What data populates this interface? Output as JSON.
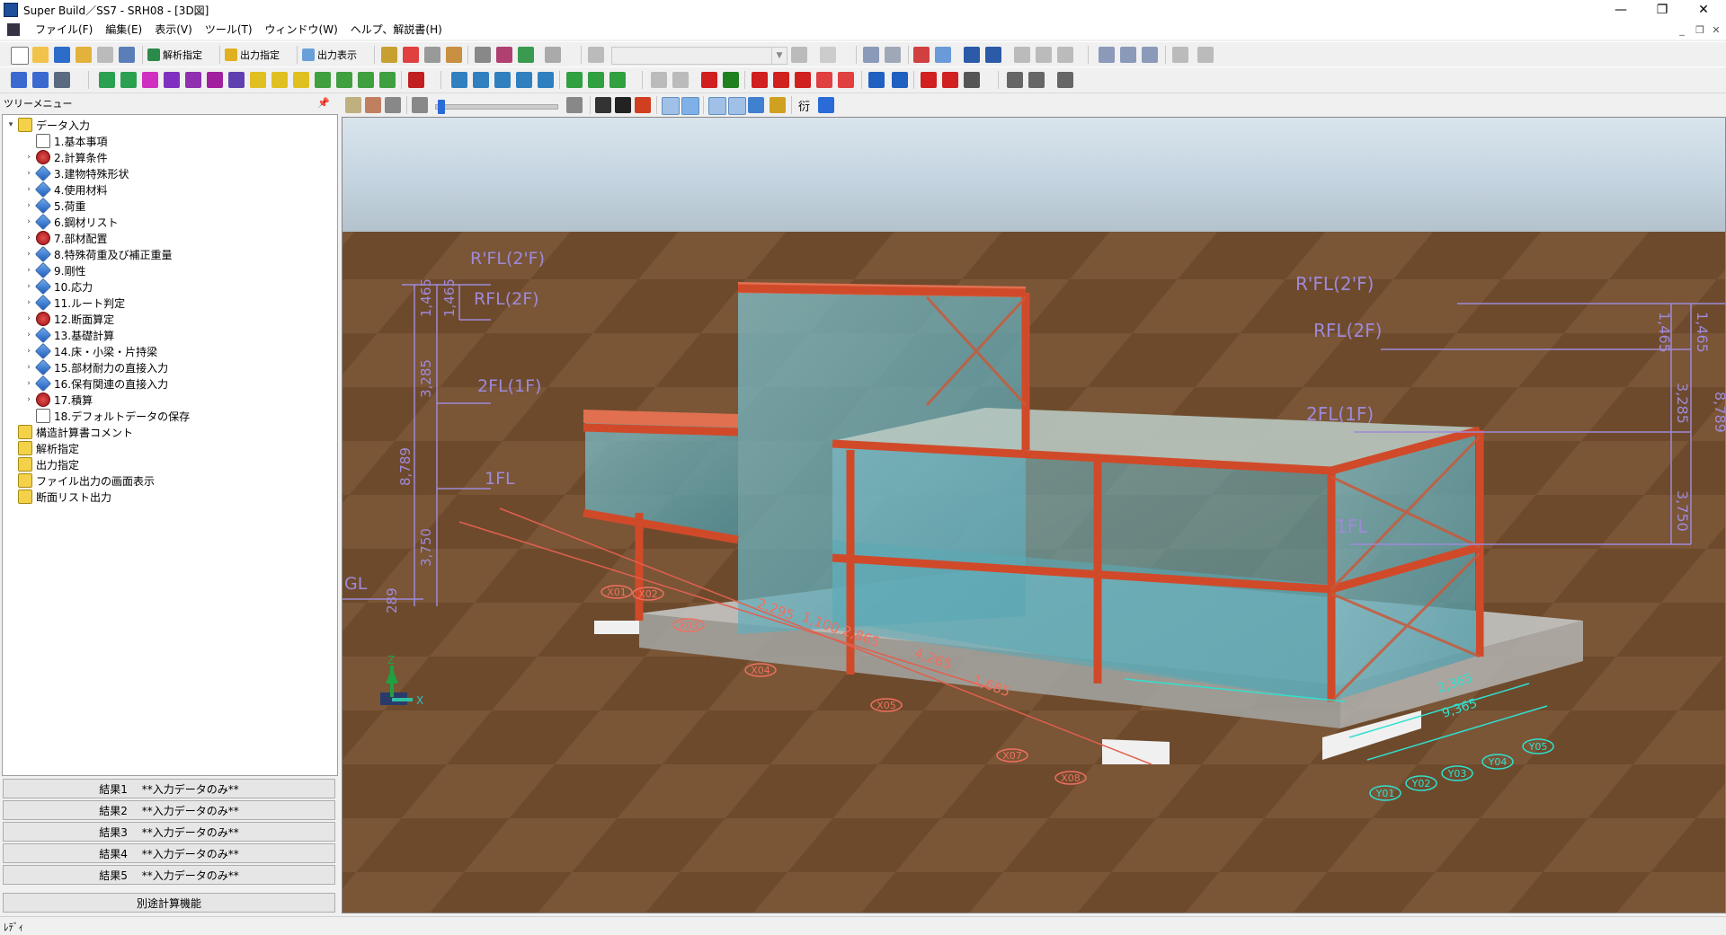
{
  "window": {
    "title": "Super Build／SS7 - SRH08 - [3D図]",
    "minimize": "—",
    "maximize": "❐",
    "close": "✕"
  },
  "mdi": {
    "minimize": "_",
    "restore": "❐",
    "close": "✕"
  },
  "menu": [
    "ファイル(F)",
    "編集(E)",
    "表示(V)",
    "ツール(T)",
    "ウィンドウ(W)",
    "ヘルプ、解説書(H)"
  ],
  "toolbar1": {
    "analysis": "解析指定",
    "output": "出力指定",
    "display": "出力表示"
  },
  "tree": {
    "header": "ツリーメニュー",
    "pin": "📌",
    "items": [
      {
        "label": "データ入力",
        "level": 0,
        "expander": "▾",
        "icon": "data-input-icon"
      },
      {
        "label": "1.基本事項",
        "level": 1,
        "expander": "",
        "icon": "doc-icon"
      },
      {
        "label": "2.計算条件",
        "level": 1,
        "expander": "›",
        "icon": "calc-condition-icon"
      },
      {
        "label": "3.建物特殊形状",
        "level": 1,
        "expander": "›",
        "icon": "building-shape-icon"
      },
      {
        "label": "4.使用材料",
        "level": 1,
        "expander": "›",
        "icon": "material-icon"
      },
      {
        "label": "5.荷重",
        "level": 1,
        "expander": "›",
        "icon": "load-icon"
      },
      {
        "label": "6.鋼材リスト",
        "level": 1,
        "expander": "›",
        "icon": "steel-list-icon"
      },
      {
        "label": "7.部材配置",
        "level": 1,
        "expander": "›",
        "icon": "member-layout-icon"
      },
      {
        "label": "8.特殊荷重及び補正重量",
        "level": 1,
        "expander": "›",
        "icon": "special-load-icon"
      },
      {
        "label": "9.剛性",
        "level": 1,
        "expander": "›",
        "icon": "stiffness-icon"
      },
      {
        "label": "10.応力",
        "level": 1,
        "expander": "›",
        "icon": "stress-icon"
      },
      {
        "label": "11.ルート判定",
        "level": 1,
        "expander": "›",
        "icon": "route-icon"
      },
      {
        "label": "12.断面算定",
        "level": 1,
        "expander": "›",
        "icon": "section-icon"
      },
      {
        "label": "13.基礎計算",
        "level": 1,
        "expander": "›",
        "icon": "foundation-icon"
      },
      {
        "label": "14.床・小梁・片持梁",
        "level": 1,
        "expander": "›",
        "icon": "floor-icon"
      },
      {
        "label": "15.部材耐力の直接入力",
        "level": 1,
        "expander": "›",
        "icon": "capacity-icon"
      },
      {
        "label": "16.保有関連の直接入力",
        "level": 1,
        "expander": "›",
        "icon": "retention-icon"
      },
      {
        "label": "17.積算",
        "level": 1,
        "expander": "›",
        "icon": "estimate-icon"
      },
      {
        "label": "18.デフォルトデータの保存",
        "level": 1,
        "expander": "",
        "icon": "doc-icon"
      },
      {
        "label": "構造計算書コメント",
        "level": 0,
        "expander": "",
        "icon": "comment-icon"
      },
      {
        "label": "解析指定",
        "level": 0,
        "expander": "",
        "icon": "analysis-icon"
      },
      {
        "label": "出力指定",
        "level": 0,
        "expander": "",
        "icon": "output-icon"
      },
      {
        "label": "ファイル出力の画面表示",
        "level": 0,
        "expander": "",
        "icon": "file-view-icon"
      },
      {
        "label": "断面リスト出力",
        "level": 0,
        "expander": "",
        "icon": "section-list-icon"
      }
    ]
  },
  "results": [
    "結果1　 **入力データのみ**",
    "結果2　 **入力データのみ**",
    "結果3　 **入力データのみ**",
    "結果4　 **入力データのみ**",
    "結果5　 **入力データのみ**"
  ],
  "separate_calc": "別途計算機能",
  "viewport": {
    "left_levels": {
      "rfl2": "R'FL(2'F)",
      "rfl": "RFL(2F)",
      "fl2": "2FL(1F)",
      "fl1": "1FL",
      "gl": "GL"
    },
    "left_dims": {
      "d1465a": "1,465",
      "d1465b": "1,465",
      "d3285": "3,285",
      "d8789": "8,789",
      "d3750": "3,750",
      "d289": "289"
    },
    "right_levels": {
      "rfl2": "R'FL(2'F)",
      "rfl": "RFL(2F)",
      "fl2": "2FL(1F)",
      "fl1": "1FL"
    },
    "right_dims": {
      "d1465a": "1,465",
      "d1465b": "1,465",
      "d3285": "3,285",
      "d8789": "8,789",
      "d3750": "3,750"
    },
    "x_dims": {
      "d4265": "4,265",
      "d2865": "2,865",
      "d1685": "1,685",
      "d2295": "2,295",
      "d1100": "1,100"
    },
    "axes_x": [
      "X01",
      "X02",
      "X03",
      "X04",
      "X05",
      "X07",
      "X08"
    ],
    "axes_y": [
      "Y01",
      "Y02",
      "Y03",
      "Y04",
      "Y05"
    ],
    "y_dims": {
      "d2365": "2,365",
      "d9365": "9,365"
    },
    "axis_z": "Z",
    "axis_x": "X"
  },
  "status": "ﾚﾃﾞｨ"
}
